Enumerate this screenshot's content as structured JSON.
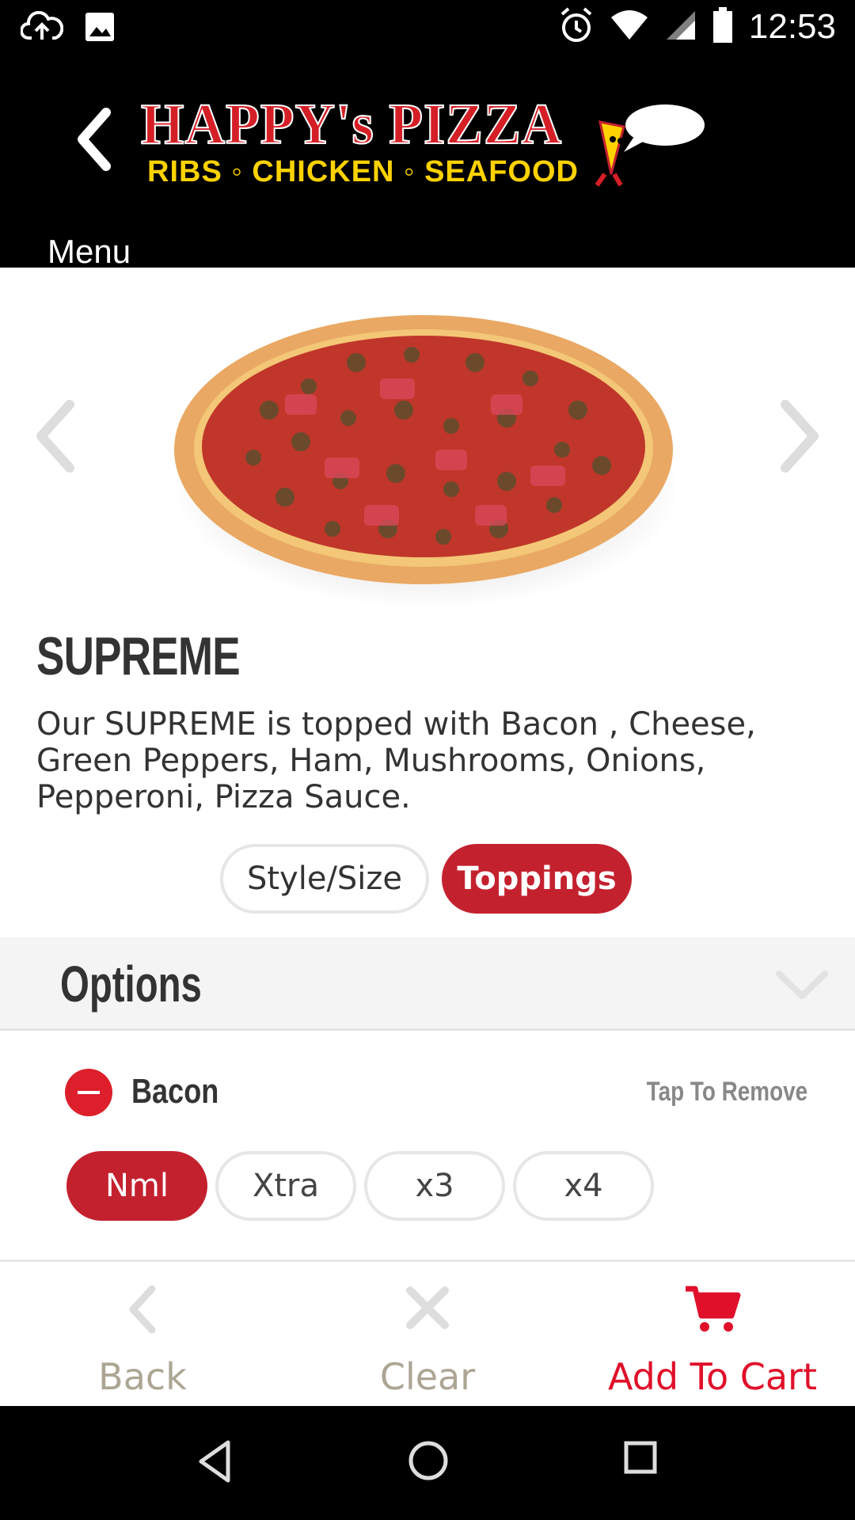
{
  "status_bar": {
    "time": "12:53",
    "icons": [
      "cloud-upload-icon",
      "image-icon",
      "alarm-icon",
      "wifi-icon",
      "signal-icon",
      "battery-icon"
    ]
  },
  "header": {
    "back_label": "Menu",
    "logo_title": "HAPPY's PIZZA",
    "logo_subtitle": "RIBS ◦ CHICKEN ◦ SEAFOOD"
  },
  "product": {
    "name": "SUPREME",
    "description": "Our SUPREME is topped with Bacon , Cheese, Green Peppers, Ham, Mushrooms, Onions, Pepperoni, Pizza Sauce."
  },
  "tabs": [
    {
      "label": "Style/Size",
      "active": false
    },
    {
      "label": "Toppings",
      "active": true
    }
  ],
  "options": {
    "title": "Options",
    "topping": {
      "name": "Bacon",
      "action_hint": "Tap To Remove",
      "quantities": [
        {
          "label": "Nml",
          "selected": true
        },
        {
          "label": "Xtra",
          "selected": false
        },
        {
          "label": "x3",
          "selected": false
        },
        {
          "label": "x4",
          "selected": false
        }
      ]
    }
  },
  "actions": {
    "back_label": "Back",
    "clear_label": "Clear",
    "cart_label": "Add To Cart"
  },
  "colors": {
    "brand_red": "#c4212f",
    "cart_red": "#e0102a",
    "logo_yellow": "#ffd200",
    "muted": "#ada594"
  }
}
